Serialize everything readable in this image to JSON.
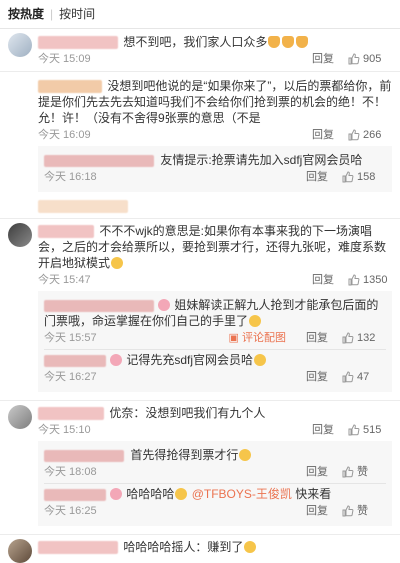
{
  "sort": {
    "hot": "按热度",
    "time": "按时间"
  },
  "comments": [
    {
      "text": "想不到吧，我们家人口众多",
      "time": "今天 15:09",
      "reply": "回复",
      "likes": "905"
    },
    {
      "text": "没想到吧他说的是“如果你来了”，以后的票都给你，前提是你们先去先去知道吗我们不会给你们抢到票的机会的绝！不！允！许！（没有不舍得9张票的意思（不是",
      "time": "今天 16:09",
      "reply": "回复",
      "likes": "266",
      "subs": [
        {
          "text": "友情提示:抢票请先加入sdfj官网会员哈",
          "time": "今天 16:18",
          "reply": "回复",
          "likes": "158"
        }
      ]
    },
    {
      "text": "不不不wjk的意思是:如果你有本事来我的下一场演唱会，之后的才会给票所以，要抢到票才行，还得九张呢，难度系数开启地狱模式",
      "time": "今天 15:47",
      "reply": "回复",
      "likes": "1350",
      "subs": [
        {
          "text": "姐妹解读正解九人抢到才能承包后面的门票哦，命运掌握在你们自己的手里了",
          "time": "今天 15:57",
          "reply": "回复",
          "likes": "132",
          "extra": "评论配图"
        },
        {
          "text": "记得先充sdfj官网会员哈",
          "time": "今天 16:27",
          "reply": "回复",
          "likes": "47"
        }
      ]
    },
    {
      "text": "优奈：没想到吧我们有九个人",
      "time": "今天 15:10",
      "reply": "回复",
      "likes": "515",
      "subs": [
        {
          "text": "首先得抢得到票才行",
          "time": "今天 18:08",
          "reply": "回复",
          "likes": "赞"
        },
        {
          "text": "哈哈哈哈",
          "mention": "@TFBOYS-王俊凯",
          "after": " 快来看",
          "time": "今天 16:25",
          "reply": "回复",
          "likes": "赞"
        }
      ]
    },
    {
      "text": "哈哈哈哈摇人：赚到了"
    }
  ]
}
